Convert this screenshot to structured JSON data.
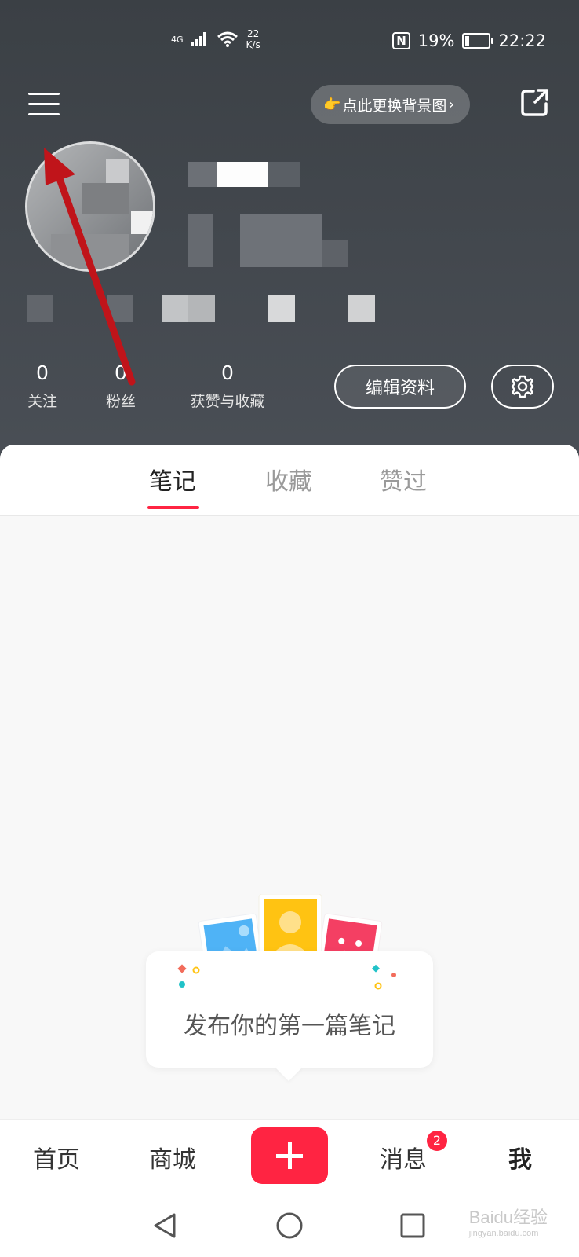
{
  "status_bar": {
    "network": "4G",
    "speed_value": "22",
    "speed_unit": "K/s",
    "nfc": "N",
    "battery": "19%",
    "battery_level": 0.19,
    "time": "22:22"
  },
  "header": {
    "bg_hint": "点此更换背景图",
    "bg_hint_emoji": "👉",
    "bg_hint_chevron": "›"
  },
  "stats": [
    {
      "value": "0",
      "label": "关注"
    },
    {
      "value": "0",
      "label": "粉丝"
    },
    {
      "value": "0",
      "label": "获赞与收藏"
    }
  ],
  "actions": {
    "edit_profile": "编辑资料"
  },
  "tabs": [
    {
      "label": "笔记",
      "active": true
    },
    {
      "label": "收藏",
      "active": false
    },
    {
      "label": "赞过",
      "active": false
    }
  ],
  "empty_state": {
    "text": "发布你的第一篇笔记"
  },
  "bottom_nav": {
    "items": [
      {
        "label": "首页"
      },
      {
        "label": "商城"
      },
      {
        "label": "消息",
        "badge": "2"
      },
      {
        "label": "我",
        "active": true
      }
    ]
  },
  "watermark": {
    "brand": "Bai",
    "paw": "du",
    "suffix": "经验",
    "url": "jingyan.baidu.com"
  },
  "colors": {
    "accent": "#ff2442",
    "header_bg": "#44494f",
    "annotation_arrow": "#c0141a"
  }
}
